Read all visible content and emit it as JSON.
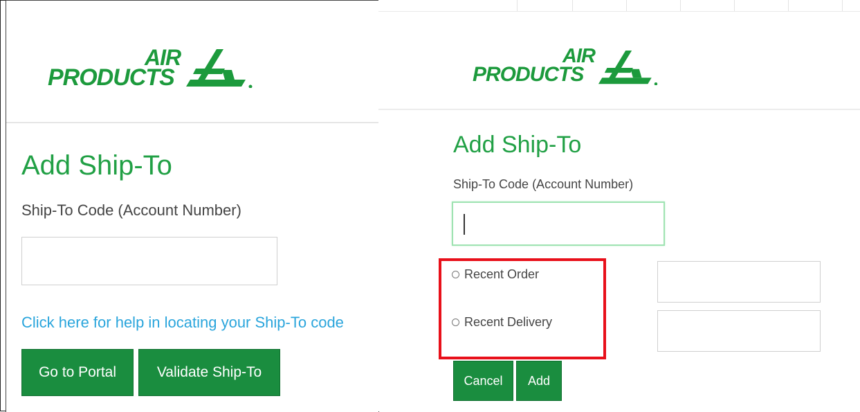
{
  "left_panel": {
    "logo": {
      "line1": "AIR",
      "line2": "PRODUCTS"
    },
    "title": "Add Ship-To",
    "code_label": "Ship-To Code (Account Number)",
    "code_input": {
      "value": "",
      "placeholder": ""
    },
    "help_link": "Click here for help in locating your Ship-To code",
    "go_to_portal_button": "Go to Portal",
    "validate_button": "Validate Ship-To"
  },
  "right_panel": {
    "logo": {
      "line1": "AIR",
      "line2": "PRODUCTS"
    },
    "title": "Add Ship-To",
    "code_label": "Ship-To Code (Account Number)",
    "code_input": {
      "value": "",
      "placeholder": ""
    },
    "options": [
      {
        "label": "Recent Order",
        "selected": false
      },
      {
        "label": "Recent Delivery",
        "selected": false
      }
    ],
    "recent_order_input": {
      "value": ""
    },
    "recent_delivery_input": {
      "value": ""
    },
    "cancel_button": "Cancel",
    "add_button": "Add"
  },
  "colors": {
    "brand_green": "#1c9a3c",
    "title_green": "#21a045",
    "button_green": "#1a8d3f",
    "link_blue": "#2aa5dc",
    "highlight_red": "#e8101a"
  },
  "icons": [
    "air-products-logo-mark",
    "radio-button-icon"
  ]
}
